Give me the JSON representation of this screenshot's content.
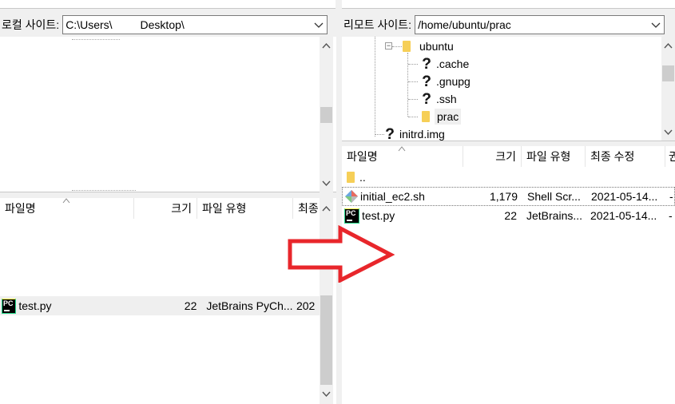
{
  "local": {
    "site_label": "로컬 사이트:",
    "path": "C:\\Users\\         Desktop\\",
    "columns": [
      "파일명",
      "크기",
      "파일 유형",
      "최종"
    ],
    "files": [
      {
        "name": "test.py",
        "size": "22",
        "type": "JetBrains PyCh...",
        "modified": "202",
        "icon": "pycharm-icon"
      }
    ]
  },
  "remote": {
    "site_label": "리모트 사이트:",
    "path": "/home/ubuntu/prac",
    "tree": [
      {
        "name": "ubuntu",
        "icon": "folder-icon",
        "expanded": true
      },
      {
        "name": ".cache",
        "icon": "unknown-icon"
      },
      {
        "name": ".gnupg",
        "icon": "unknown-icon"
      },
      {
        "name": ".ssh",
        "icon": "unknown-icon"
      },
      {
        "name": "prac",
        "icon": "folder-icon"
      },
      {
        "name": "initrd.img",
        "icon": "unknown-icon"
      }
    ],
    "columns": [
      "파일명",
      "크기",
      "파일 유형",
      "최종 수정",
      "권"
    ],
    "files": [
      {
        "name": "..",
        "size": "",
        "type": "",
        "modified": "",
        "perm": "",
        "icon": "folder-icon"
      },
      {
        "name": "initial_ec2.sh",
        "size": "1,179",
        "type": "Shell Scr...",
        "modified": "2021-05-14...",
        "perm": "-",
        "icon": "shell-script-icon"
      },
      {
        "name": "test.py",
        "size": "22",
        "type": "JetBrains...",
        "modified": "2021-05-14...",
        "perm": "-",
        "icon": "pycharm-icon"
      }
    ]
  },
  "annotation": {
    "shape": "right-arrow",
    "color": "#e8262b"
  },
  "colors": {
    "scroll_thumb": "#cdcdcd",
    "selection": "#efefef",
    "folder": "#f6cf57",
    "unknown": "#ffd43b"
  }
}
